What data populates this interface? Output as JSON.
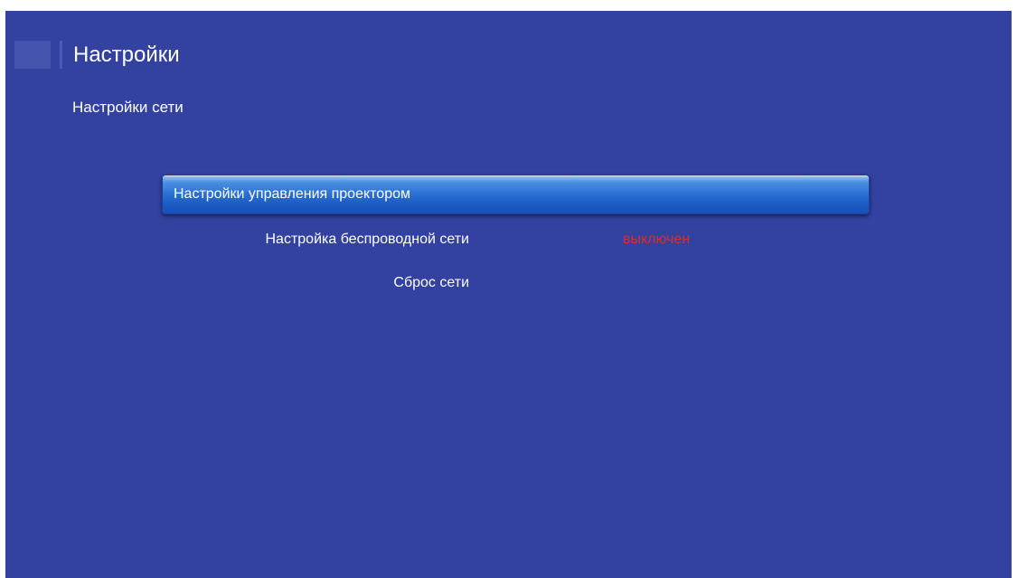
{
  "header": {
    "title": "Настройки"
  },
  "section": {
    "title": "Настройки сети"
  },
  "menu": {
    "items": [
      {
        "label": "Настройки управления проектором",
        "value": "",
        "selected": true
      },
      {
        "label": "Настройка беспроводной сети",
        "value": "выключен",
        "selected": false
      },
      {
        "label": "Сброс сети",
        "value": "",
        "selected": false
      }
    ]
  },
  "colors": {
    "background": "#3342a0",
    "selection": "#2a6fd2",
    "value_off": "#d32f2f",
    "text": "#ffffff"
  }
}
